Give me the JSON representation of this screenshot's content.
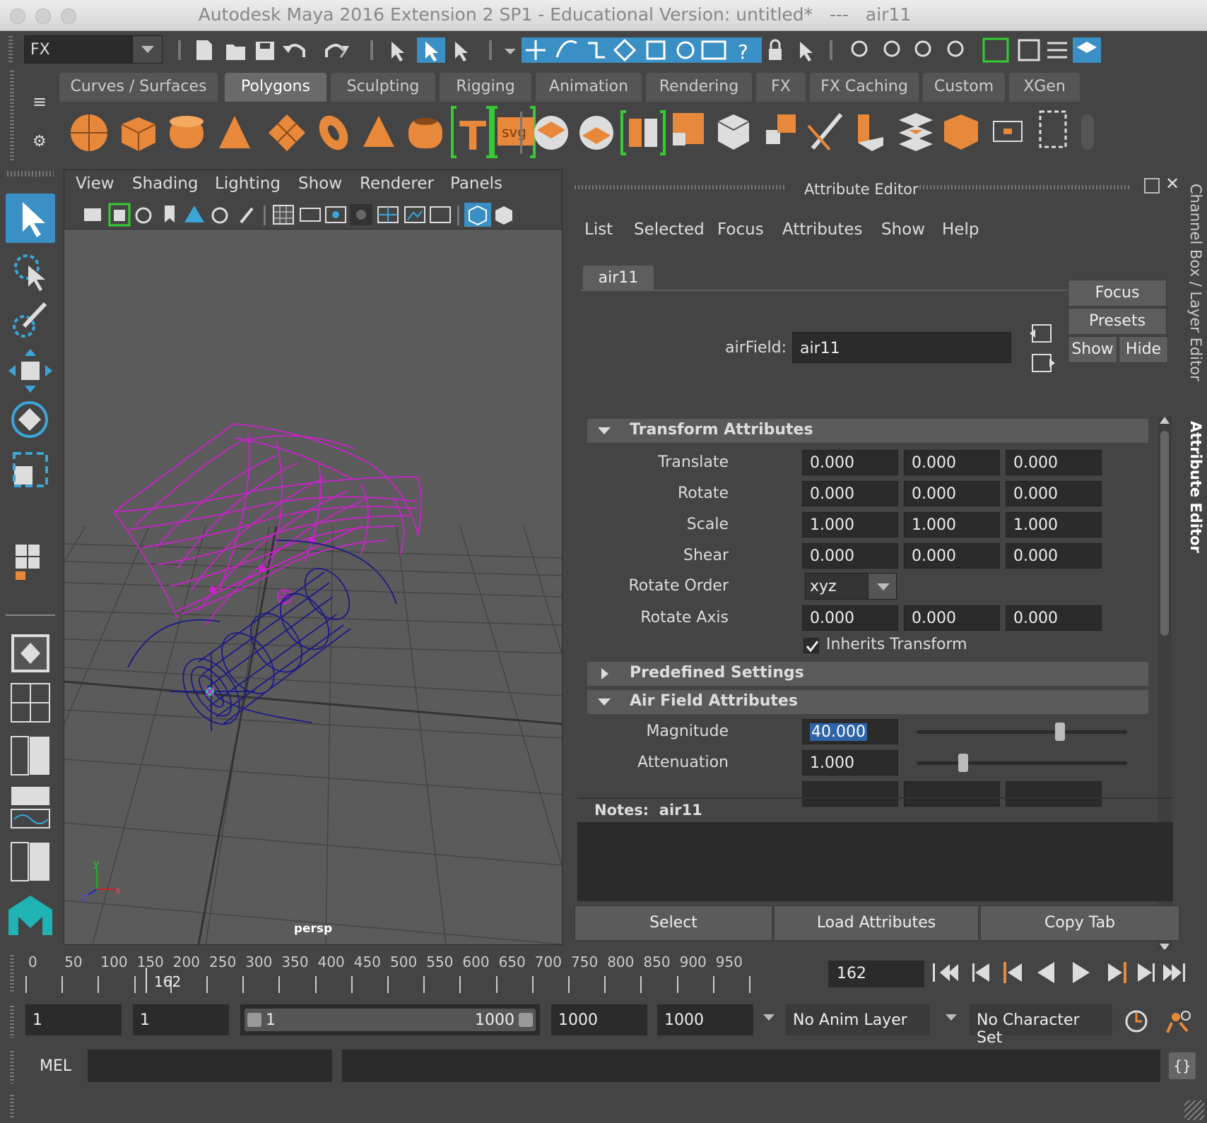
{
  "window": {
    "title": "Autodesk Maya 2016 Extension 2 SP1 - Educational Version: untitled*   ---   air11"
  },
  "toolbar": {
    "menu_set": "FX"
  },
  "shelf": {
    "tabs": [
      "Curves / Surfaces",
      "Polygons",
      "Sculpting",
      "Rigging",
      "Animation",
      "Rendering",
      "FX",
      "FX Caching",
      "Custom",
      "XGen"
    ],
    "active_tab": "Polygons",
    "text_icon_label": "T",
    "svg_icon_label": "svg"
  },
  "viewport": {
    "menus": [
      "View",
      "Shading",
      "Lighting",
      "Show",
      "Renderer",
      "Panels"
    ],
    "camera_label": "persp",
    "axis_labels": {
      "x": "x",
      "y": "y",
      "z": "z"
    }
  },
  "attribute_editor": {
    "title": "Attribute Editor",
    "menus": [
      "List",
      "Selected",
      "Focus",
      "Attributes",
      "Show",
      "Help"
    ],
    "node_tab": "air11",
    "node_type_label": "airField:",
    "node_name": "air11",
    "buttons": {
      "focus": "Focus",
      "presets": "Presets",
      "show": "Show",
      "hide": "Hide"
    },
    "sections": {
      "transform": "Transform Attributes",
      "predefined": "Predefined Settings",
      "air_field": "Air Field Attributes"
    },
    "transform": {
      "translate": {
        "label": "Translate",
        "values": [
          "0.000",
          "0.000",
          "0.000"
        ]
      },
      "rotate": {
        "label": "Rotate",
        "values": [
          "0.000",
          "0.000",
          "0.000"
        ]
      },
      "scale": {
        "label": "Scale",
        "values": [
          "1.000",
          "1.000",
          "1.000"
        ]
      },
      "shear": {
        "label": "Shear",
        "values": [
          "0.000",
          "0.000",
          "0.000"
        ]
      },
      "rotate_order": {
        "label": "Rotate Order",
        "value": "xyz"
      },
      "rotate_axis": {
        "label": "Rotate Axis",
        "values": [
          "0.000",
          "0.000",
          "0.000"
        ]
      },
      "inherits_transform": {
        "label": "Inherits Transform",
        "checked": true
      }
    },
    "air_field": {
      "magnitude": {
        "label": "Magnitude",
        "value": "40.000",
        "slider": 0.68
      },
      "attenuation": {
        "label": "Attenuation",
        "value": "1.000",
        "slider": 0.22
      }
    },
    "notes_label": "Notes:  air11",
    "bottom_buttons": {
      "select": "Select",
      "load": "Load Attributes",
      "copy": "Copy Tab"
    }
  },
  "side_tabs": {
    "channel_box": "Channel Box / Layer Editor",
    "attribute_editor": "Attribute Editor"
  },
  "timeline": {
    "ticks": [
      "0",
      "50",
      "100",
      "150",
      "200",
      "250",
      "300",
      "350",
      "400",
      "450",
      "500",
      "550",
      "600",
      "650",
      "700",
      "750",
      "800",
      "850",
      "900",
      "950"
    ],
    "playhead_label": "162",
    "current_frame": "162"
  },
  "range": {
    "start": "1",
    "playback_start": "1",
    "slider_start": "1",
    "slider_end": "1000",
    "playback_end": "1000",
    "end": "1000",
    "anim_layer": "No Anim Layer",
    "character_set": "No Character Set"
  },
  "command_line": {
    "language": "MEL",
    "input": "",
    "output": ""
  },
  "colors": {
    "bg": "#444444",
    "accent_blue": "#3a8fc4",
    "orange": "#e8883a",
    "magenta_wire": "#cc22cc",
    "navy_wire": "#1a1a88"
  }
}
